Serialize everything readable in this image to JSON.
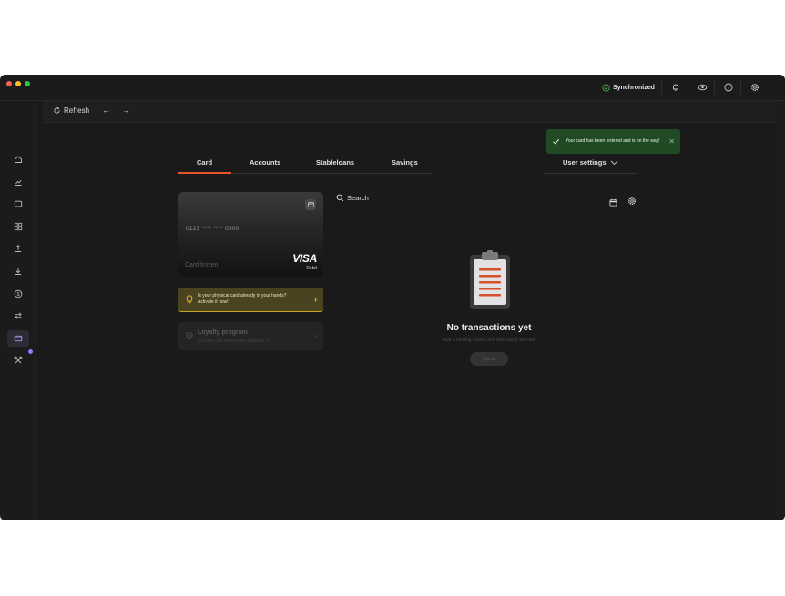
{
  "titlebar": {
    "sync_label": "Synchronized",
    "icons": [
      "bell-icon",
      "eye-icon",
      "help-icon",
      "gear-icon"
    ]
  },
  "sidebar": {
    "items": [
      "home-icon",
      "chart-icon",
      "wallet-icon",
      "grid-icon",
      "upload-icon",
      "download-icon",
      "dollar-icon",
      "transfer-icon",
      "card-icon",
      "tools-icon"
    ],
    "active": "card-icon"
  },
  "toolbar": {
    "refresh_label": "Refresh",
    "back": "←",
    "forward": "→"
  },
  "toast": {
    "message": "Your card has been ordered and is on the way!",
    "close": "✕",
    "color": "#1f4a24"
  },
  "tabs": [
    {
      "label": "Card",
      "active": true
    },
    {
      "label": "Accounts"
    },
    {
      "label": "Stableloans"
    },
    {
      "label": "Savings"
    }
  ],
  "user_settings": {
    "label": "User settings"
  },
  "card": {
    "number": "0123 **** **** 0000",
    "status": "Card frozen",
    "brand": "VISA",
    "type": "Debit"
  },
  "activate": {
    "line1": "Is your physical card already in your hands?",
    "line2": "Activate it now!",
    "accent": "#e8c23a"
  },
  "loyalty": {
    "title": "Loyalty program",
    "subtitle": "Choose coin to receive cashback in"
  },
  "transactions": {
    "search_label": "Search",
    "empty_title": "No transactions yet",
    "empty_subtitle": "Add a funding source and start using the card",
    "topup_label": "Top up"
  },
  "colors": {
    "accent": "#e8552a",
    "background": "#1a1a1a"
  }
}
